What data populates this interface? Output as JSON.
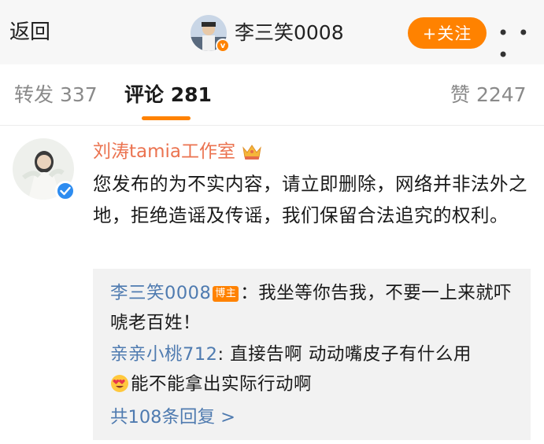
{
  "topbar": {
    "back_label": "返回",
    "username": "李三笑0008",
    "follow_label": "+关注",
    "more_label": "• • •",
    "avatar_badge": "v"
  },
  "tabs": {
    "repost": "转发 337",
    "comments": "评论 281",
    "likes": "赞 2247"
  },
  "comment": {
    "author": "刘涛tamia工作室",
    "text": "您发布的为不实内容，请立即删除，网络并非法外之地，拒绝造谣及传谣，我们保留合法追究的权利。",
    "replies": [
      {
        "user": "李三笑0008",
        "badge": "博主",
        "text": "：我坐等你告我，不要一上来就吓唬老百姓！"
      },
      {
        "user": "亲亲小桃712",
        "text": ": 直接告啊 动动嘴皮子有什么用",
        "text2": "能不能拿出实际行动啊",
        "emoji": "heart-eyes-emoji"
      }
    ],
    "more_replies": "共108条回复 >"
  },
  "colors": {
    "accent": "#ff8200",
    "author": "#eb7350",
    "link": "#4f7bb0",
    "verified": "#2d8cf0"
  }
}
